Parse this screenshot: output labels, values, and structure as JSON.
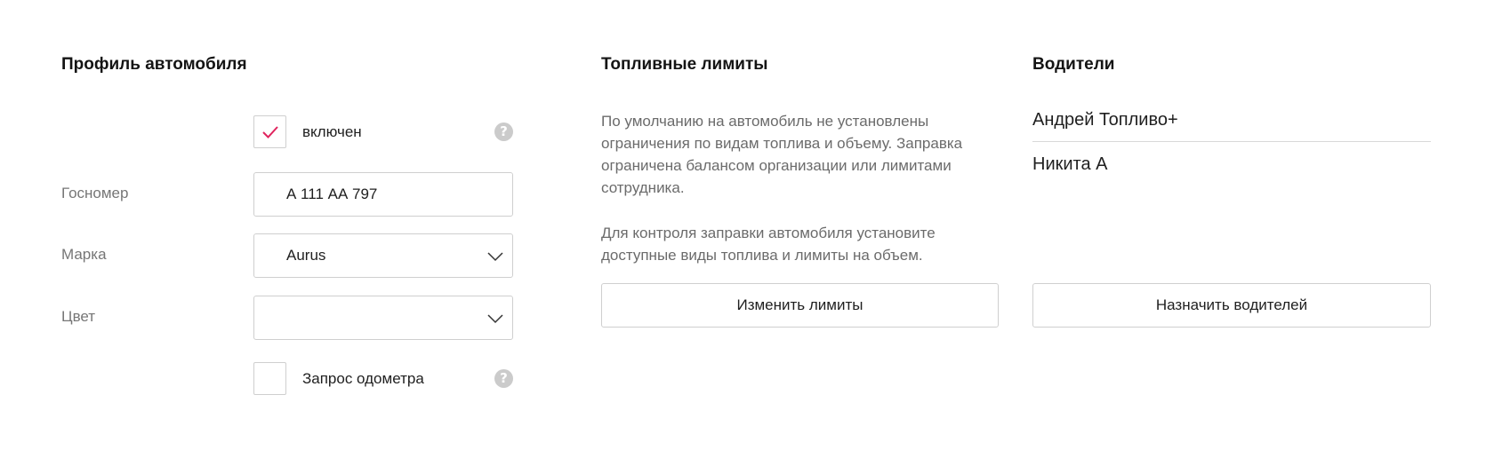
{
  "profile": {
    "title": "Профиль автомобиля",
    "enabled": {
      "label": "включен",
      "checked": true
    },
    "plate": {
      "label": "Госномер",
      "value": "А 111 АА 797"
    },
    "brand": {
      "label": "Марка",
      "value": "Aurus"
    },
    "color": {
      "label": "Цвет",
      "value": ""
    },
    "odometer": {
      "label": "Запрос одометра",
      "checked": false
    },
    "help_glyph": "?"
  },
  "fuel": {
    "title": "Топливные лимиты",
    "paragraph1": "По умолчанию на автомобиль не установлены ограничения по видам топлива и объему. Заправка ограничена балансом организации или лимитами сотрудника.",
    "paragraph2": "Для контроля заправки автомобиля установите доступные виды топлива и лимиты на объем.",
    "button_label": "Изменить лимиты"
  },
  "drivers": {
    "title": "Водители",
    "items": [
      "Андрей Топливо+",
      "Никита А"
    ],
    "button_label": "Назначить водителей"
  },
  "colors": {
    "check_accent": "#e0245e",
    "border": "#cfcfcf",
    "help_icon_bg": "#cbcbcb"
  }
}
